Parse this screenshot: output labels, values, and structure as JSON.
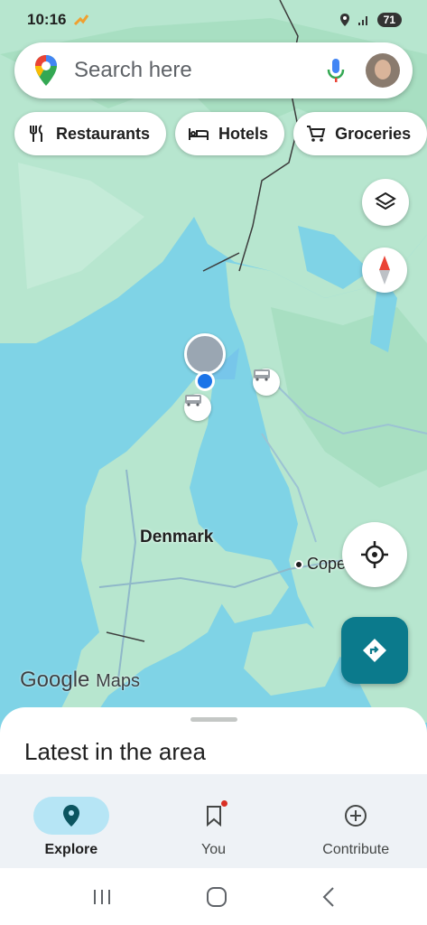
{
  "status_bar": {
    "time": "10:16",
    "battery": "71"
  },
  "search": {
    "placeholder": "Search here"
  },
  "chips": [
    {
      "label": "Restaurants",
      "icon": "fork-knife-icon"
    },
    {
      "label": "Hotels",
      "icon": "bed-icon"
    },
    {
      "label": "Groceries",
      "icon": "cart-icon"
    }
  ],
  "map": {
    "country_label": "Denmark",
    "city_label": "Cope",
    "watermark_google": "Google",
    "watermark_maps": "Maps"
  },
  "sheet": {
    "title": "Latest in the area"
  },
  "bottom_nav": [
    {
      "label": "Explore",
      "active": true
    },
    {
      "label": "You",
      "active": false
    },
    {
      "label": "Contribute",
      "active": false
    }
  ],
  "colors": {
    "water": "#7fd3e6",
    "land": "#b7e6cf",
    "accent": "#0b7a8c",
    "location": "#1a73e8"
  }
}
